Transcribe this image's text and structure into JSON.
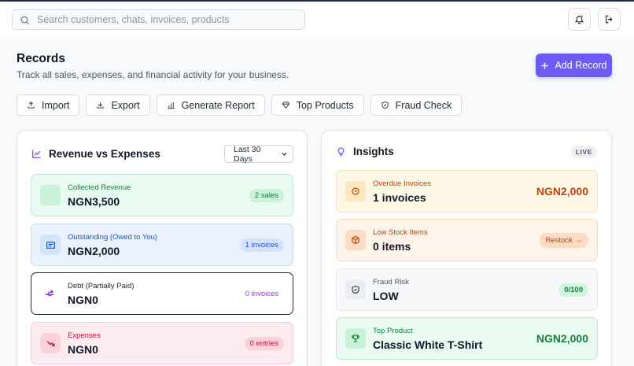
{
  "search": {
    "placeholder": "Search customers, chats, invoices, products"
  },
  "header": {
    "title": "Records",
    "subtitle": "Track all sales, expenses, and financial activity for your business.",
    "add_label": "Add Record"
  },
  "actions": [
    {
      "label": "Import",
      "icon": "upload-icon"
    },
    {
      "label": "Export",
      "icon": "download-icon"
    },
    {
      "label": "Generate Report",
      "icon": "bar-chart-icon"
    },
    {
      "label": "Top Products",
      "icon": "diamond-icon"
    },
    {
      "label": "Fraud Check",
      "icon": "shield-icon"
    }
  ],
  "revenue": {
    "title": "Revenue vs Expenses",
    "period": "Last 30 Days",
    "rows": [
      {
        "label": "Collected Revenue",
        "value": "NGN3,500",
        "badge": "2 sales",
        "accent": "#16a34a"
      },
      {
        "label": "Outstanding (Owed to You)",
        "value": "NGN2,000",
        "badge": "1 invoices",
        "accent": "#1d4ed8"
      },
      {
        "label": "Debt (Partially Paid)",
        "value": "NGN0",
        "badge": "0 invoices",
        "accent": "#9333ea"
      },
      {
        "label": "Expenses",
        "value": "NGN0",
        "badge": "0 entries",
        "accent": "#be123c"
      }
    ]
  },
  "insights": {
    "title": "Insights",
    "badge": "LIVE",
    "rows": [
      {
        "label": "Overdue Invoices",
        "value": "1 invoices",
        "amount": "NGN2,000",
        "accent": "#c2410c"
      },
      {
        "label": "Low Stock Items",
        "value": "0 items",
        "action": "Restock →",
        "accent": "#c2410c"
      },
      {
        "label": "Fraud Risk",
        "value": "LOW",
        "badge": "0/100",
        "accent": "#15803d"
      },
      {
        "label": "Top Product",
        "value": "Classic White T-Shirt",
        "amount": "NGN2,000",
        "accent": "#15803d"
      }
    ]
  }
}
